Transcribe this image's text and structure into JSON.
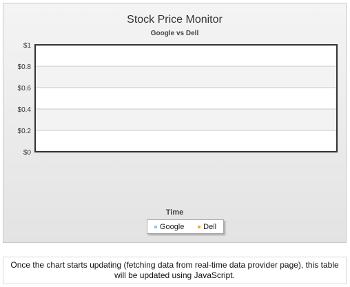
{
  "chart_data": {
    "type": "line",
    "title": "Stock Price Monitor",
    "subtitle": "Google vs Dell",
    "xlabel": "Time",
    "ylabel": "",
    "categories": [],
    "series": [
      {
        "name": "Google",
        "values": [],
        "color": "#8fc4ee"
      },
      {
        "name": "Dell",
        "values": [],
        "color": "#f5a623"
      }
    ],
    "ylim": [
      0,
      1
    ],
    "yticks": [
      {
        "value": 0,
        "label": "$0"
      },
      {
        "value": 0.2,
        "label": "$0.2"
      },
      {
        "value": 0.4,
        "label": "$0.4"
      },
      {
        "value": 0.6,
        "label": "$0.6"
      },
      {
        "value": 0.8,
        "label": "$0.8"
      },
      {
        "value": 1,
        "label": "$1"
      }
    ],
    "grid": true,
    "legend_position": "bottom"
  },
  "info_text": "Once the chart starts updating (fetching data from real-time data provider page), this table will be updated using JavaScript."
}
